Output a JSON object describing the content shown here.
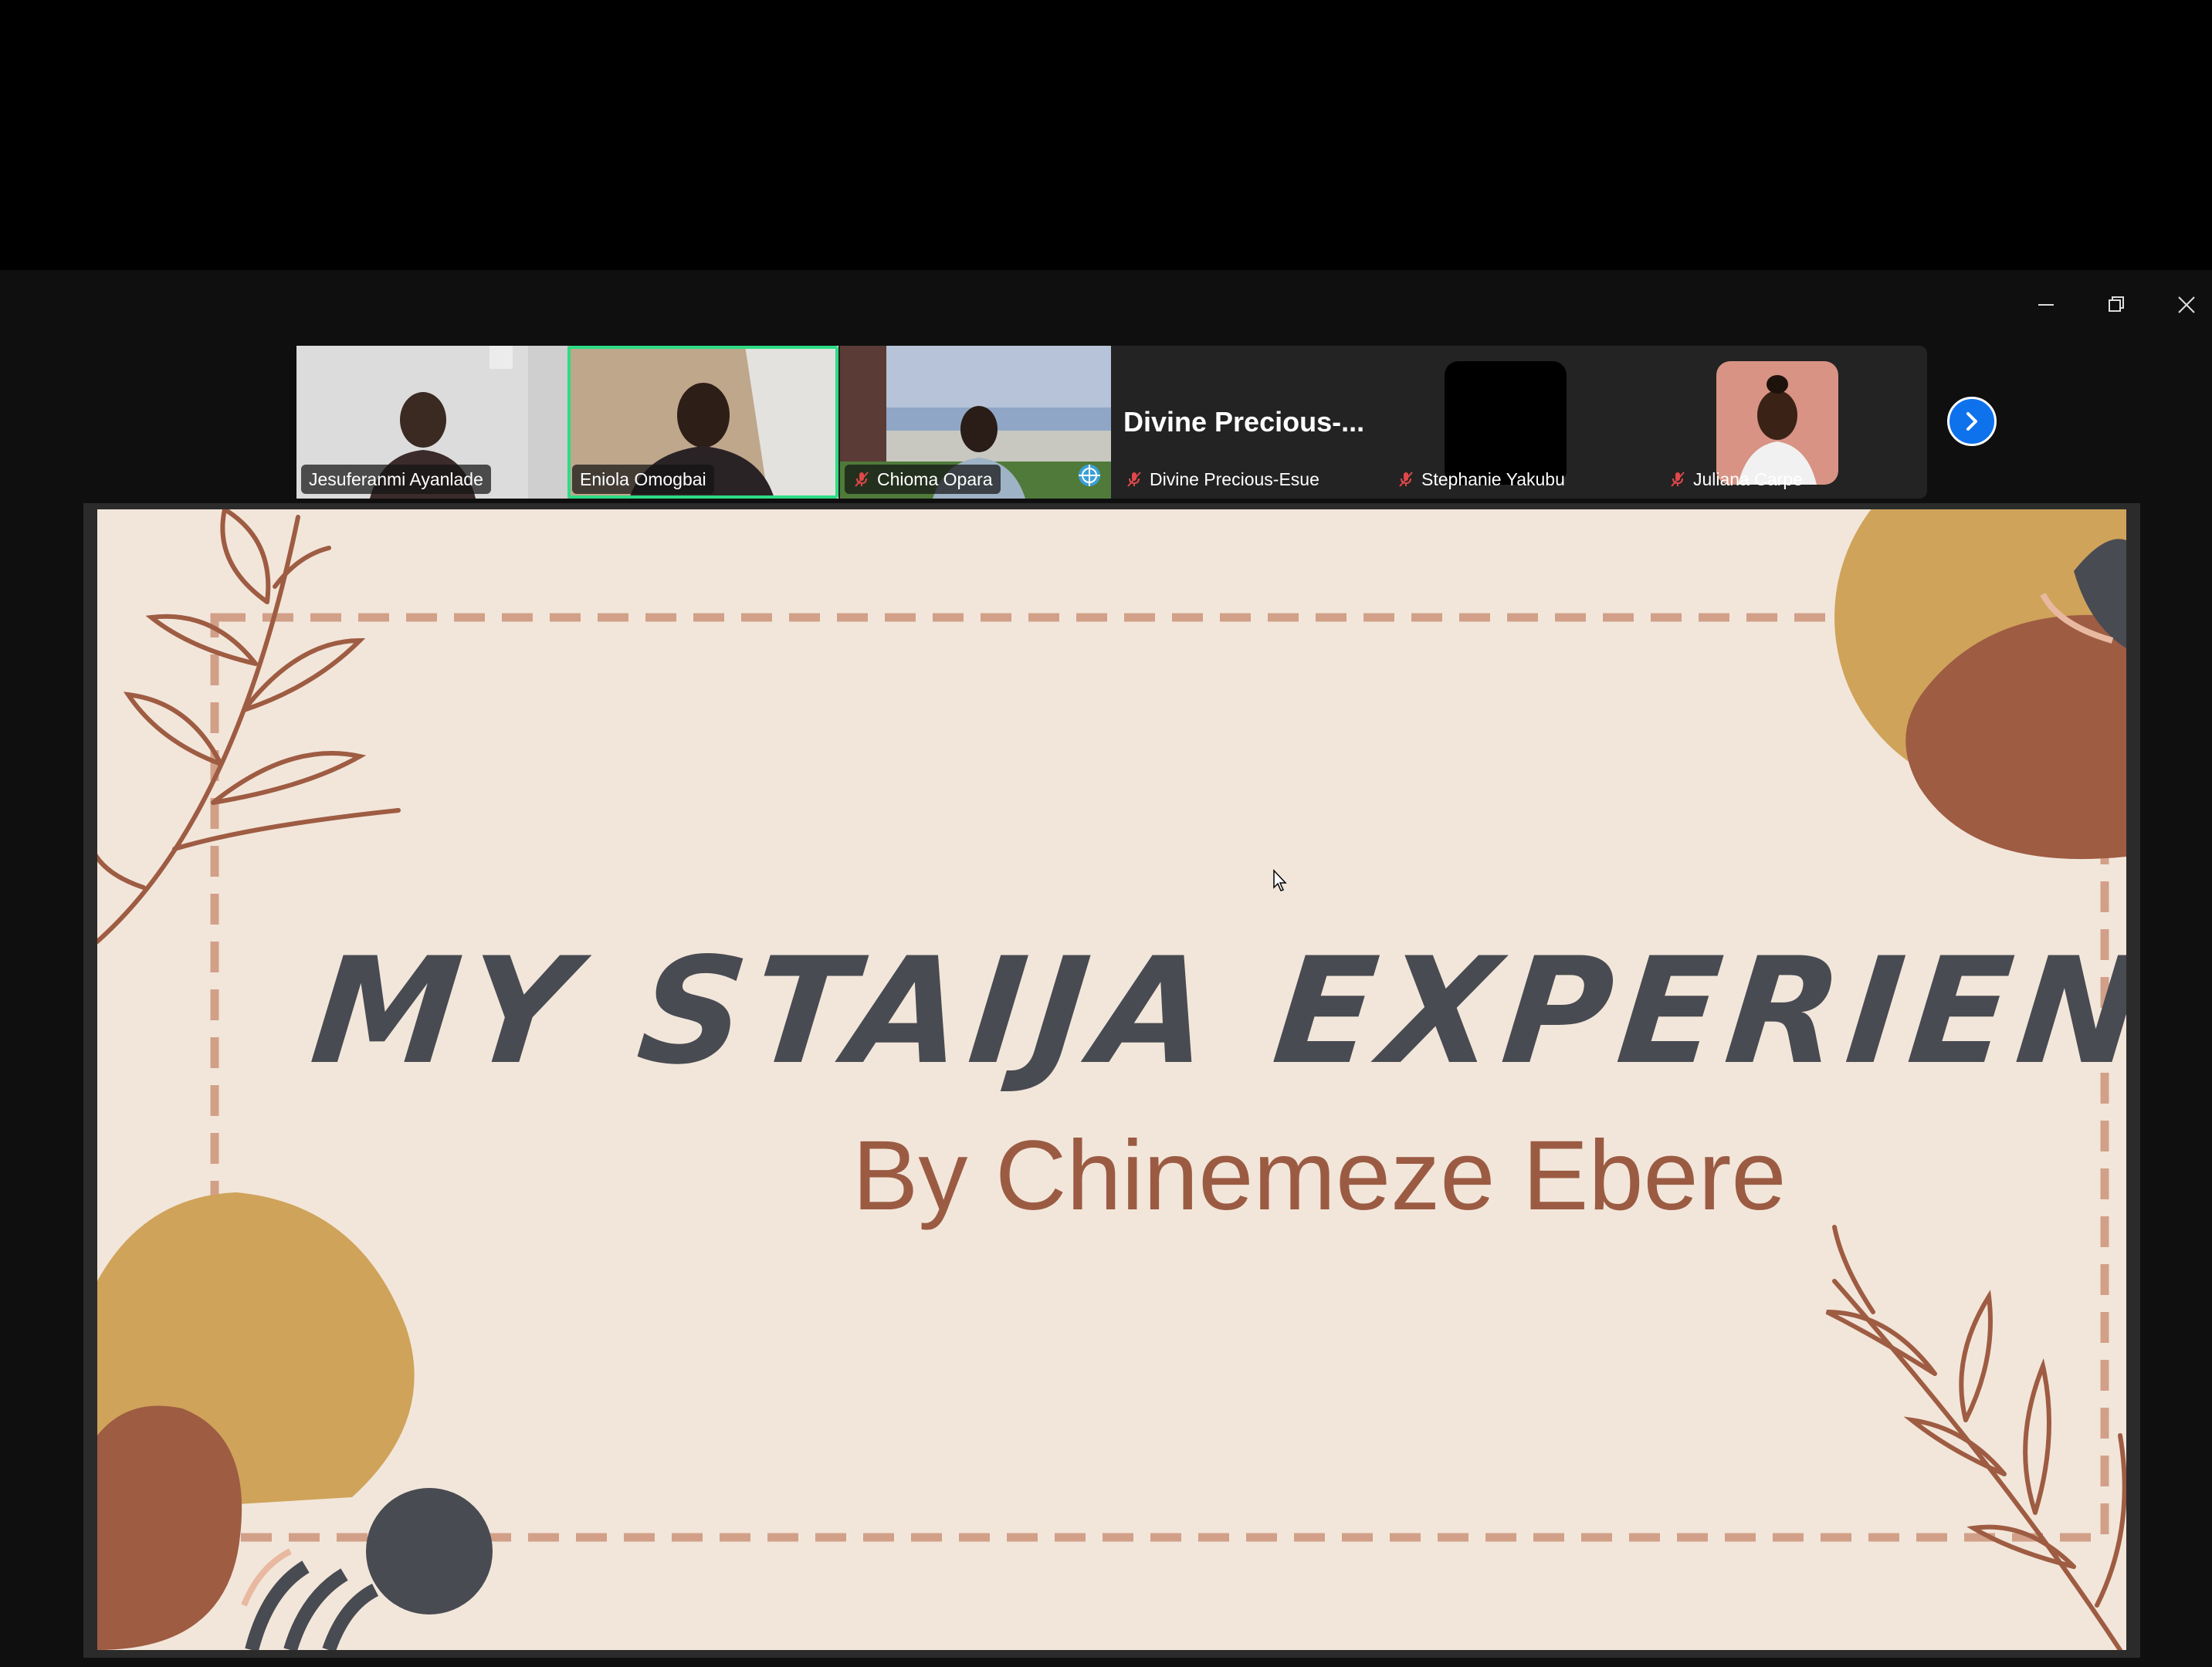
{
  "window_controls": {
    "minimize_icon": "minimize-icon",
    "restore_icon": "restore-icon",
    "close_icon": "close-icon"
  },
  "participants": [
    {
      "name": "Jesuferanmi Ayanlade",
      "muted": false,
      "active_speaker": false,
      "video": "camera"
    },
    {
      "name": "Eniola Omogbai",
      "muted": false,
      "active_speaker": true,
      "video": "camera"
    },
    {
      "name": "Chioma Opara",
      "muted": true,
      "active_speaker": false,
      "video": "camera"
    },
    {
      "name": "Divine Precious-Esue",
      "display_title": "Divine  Precious-...",
      "muted": true,
      "active_speaker": false,
      "video": "off"
    },
    {
      "name": "Stephanie Yakubu",
      "muted": true,
      "active_speaker": false,
      "video": "avatar"
    },
    {
      "name": "Juliana Carpe",
      "muted": true,
      "active_speaker": false,
      "video": "avatar"
    }
  ],
  "next_page_icon": "chevron-right-icon",
  "slide": {
    "title": "MY STAIJA EXPERIENCE",
    "subtitle": "By Chinemeze Ebere"
  },
  "colors": {
    "active_speaker_border": "#2ddc85",
    "next_button": "#0e72ed",
    "slide_background": "#f2e6da",
    "title_color": "#494b52",
    "subtitle_color": "#9b5b43",
    "accent_mustard": "#cfa35a",
    "accent_rust": "#9e5c43",
    "dash_border": "#d2a088"
  }
}
